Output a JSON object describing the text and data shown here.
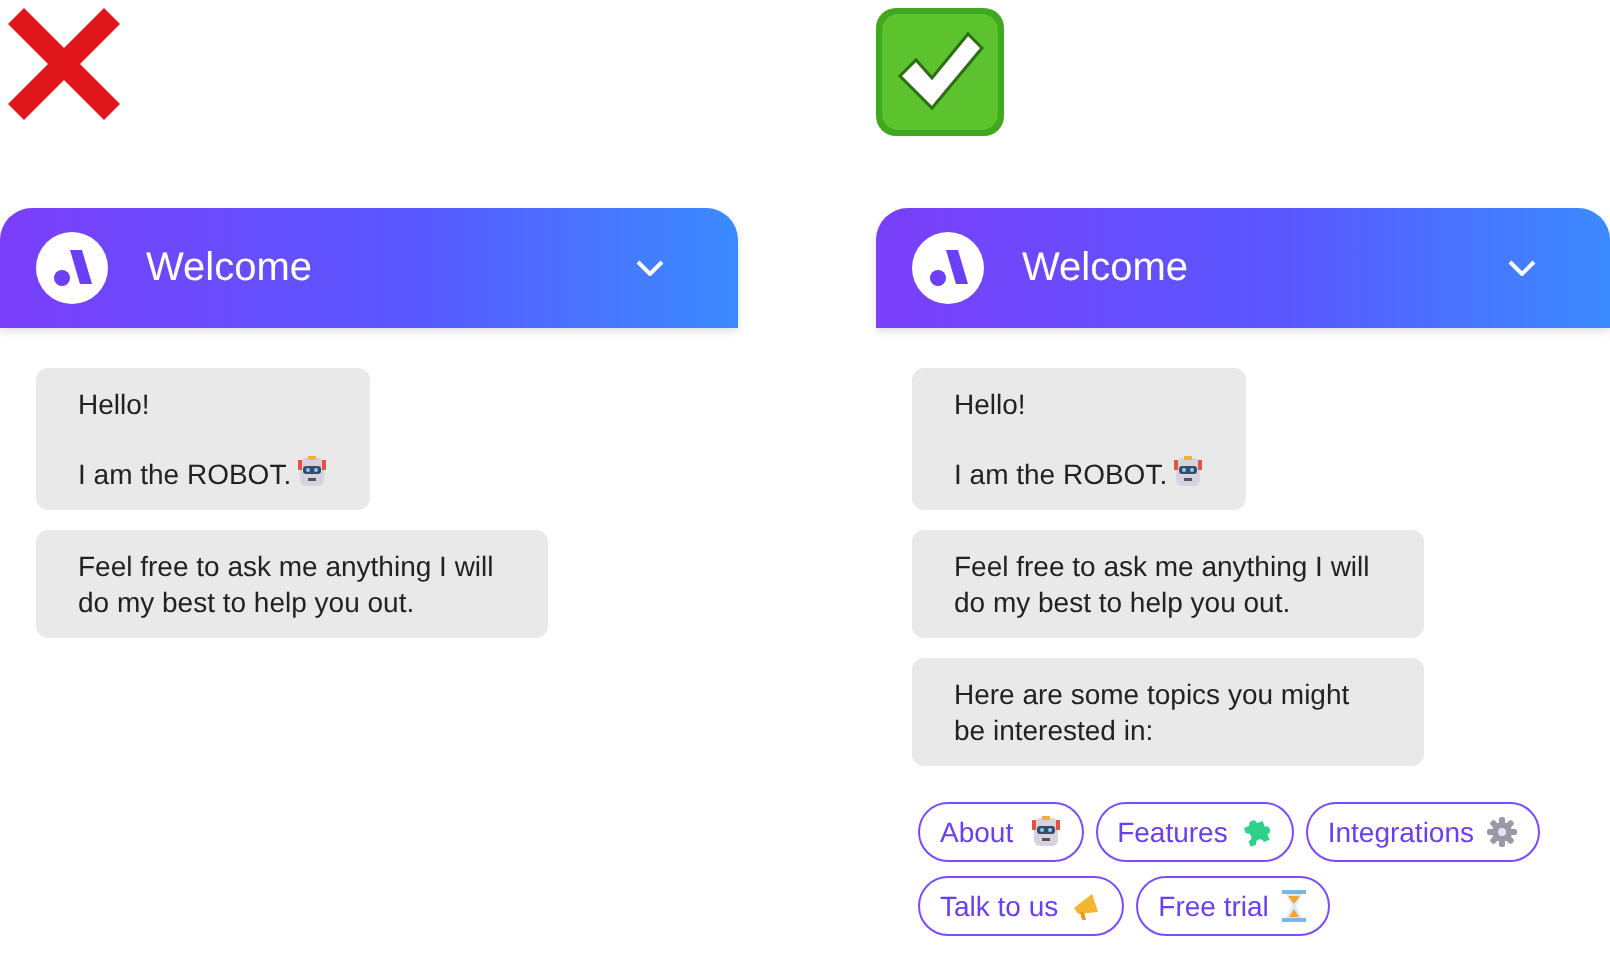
{
  "examples": [
    {
      "correct": false,
      "title": "Welcome",
      "messages": [
        {
          "lines": [
            "Hello!",
            "I am the ROBOT."
          ],
          "trailing_icon": true
        },
        {
          "lines": [
            "Feel free to ask me anything I will do my best to help you out."
          ],
          "trailing_icon": false
        }
      ]
    },
    {
      "correct": true,
      "title": "Welcome",
      "messages": [
        {
          "lines": [
            "Hello!",
            "I am the ROBOT."
          ],
          "trailing_icon": true
        },
        {
          "lines": [
            "Feel free to ask me anything I will do my best to help you out."
          ],
          "trailing_icon": false
        },
        {
          "lines": [
            "Here are some topics you might be interested in:"
          ],
          "trailing_icon": false
        }
      ],
      "quick_replies": [
        "About",
        "Features",
        "Integrations",
        "Talk to us",
        "Free trial"
      ]
    }
  ]
}
